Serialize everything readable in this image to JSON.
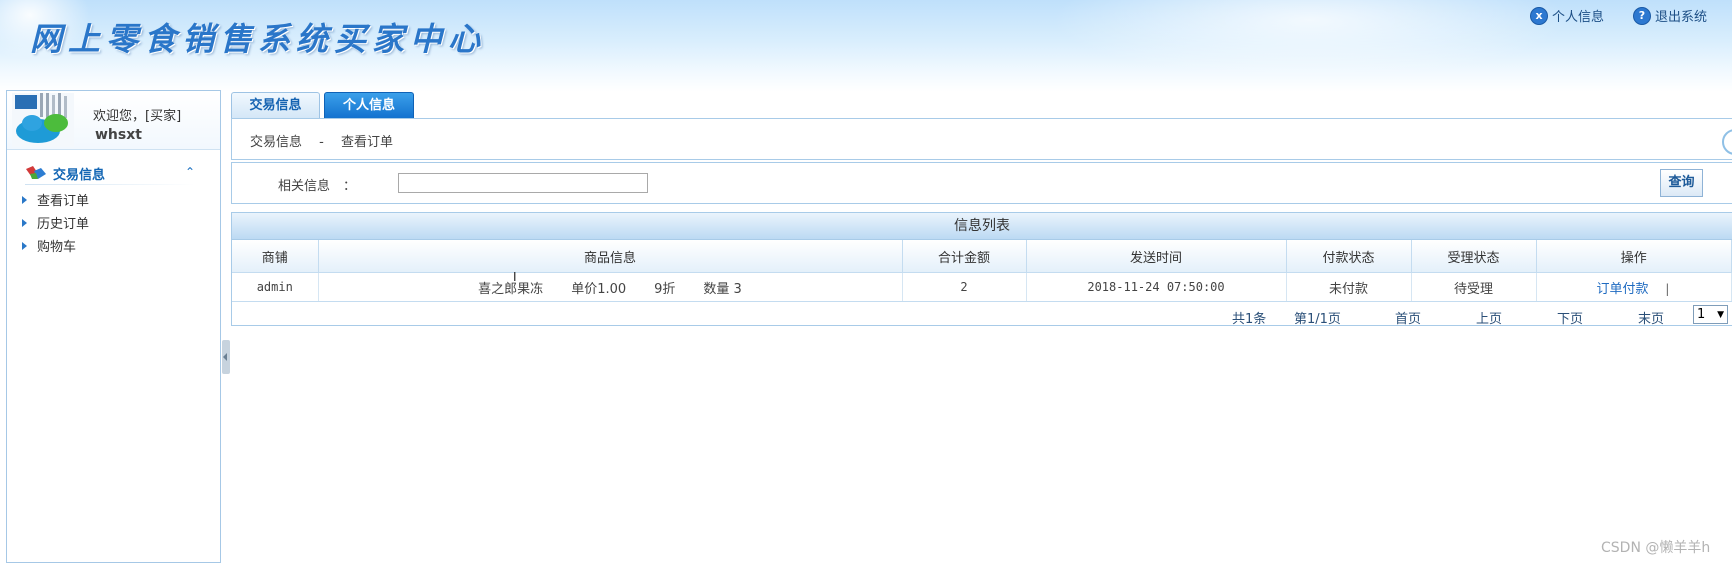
{
  "header": {
    "title": "网上零食销售系统买家中心",
    "links": [
      {
        "icon": "info-icon",
        "glyph": "x",
        "label": "个人信息"
      },
      {
        "icon": "help-icon",
        "glyph": "?",
        "label": "退出系统"
      }
    ]
  },
  "sidebar": {
    "welcome": "欢迎您，[买家]",
    "username": "whsxt",
    "section_label": "交易信息",
    "items": [
      {
        "label": "查看订单"
      },
      {
        "label": "历史订单"
      },
      {
        "label": "购物车"
      }
    ]
  },
  "tabs": [
    {
      "label": "交易信息",
      "active": false
    },
    {
      "label": "个人信息",
      "active": true
    }
  ],
  "breadcrumb": "交易信息　 -　 查看订单",
  "search": {
    "label": "相关信息　：",
    "value": "",
    "button": "查询"
  },
  "list": {
    "title": "信息列表",
    "columns": [
      "商铺",
      "商品信息",
      "合计金额",
      "发送时间",
      "付款状态",
      "受理状态",
      "操作"
    ],
    "rows": [
      {
        "shop": "admin",
        "goods_name": "喜之郎果冻",
        "unit_price": "单价1.00",
        "discount": "9折",
        "quantity": "数量 3",
        "total": "2",
        "time": "2018-11-24 07:50:00",
        "pay_status": "未付款",
        "handle_status": "待受理",
        "action": "订单付款",
        "action_sep": "|"
      }
    ]
  },
  "pager": {
    "total": "共1条",
    "page": "第1/1页",
    "first": "首页",
    "prev": "上页",
    "next": "下页",
    "last": "末页",
    "selected_page": "1"
  },
  "watermark": "CSDN @懒羊羊h",
  "colors": {
    "accent": "#1372cf",
    "title": "#2a76c9",
    "border": "#a8cbe8",
    "link": "#1f6bc1"
  }
}
